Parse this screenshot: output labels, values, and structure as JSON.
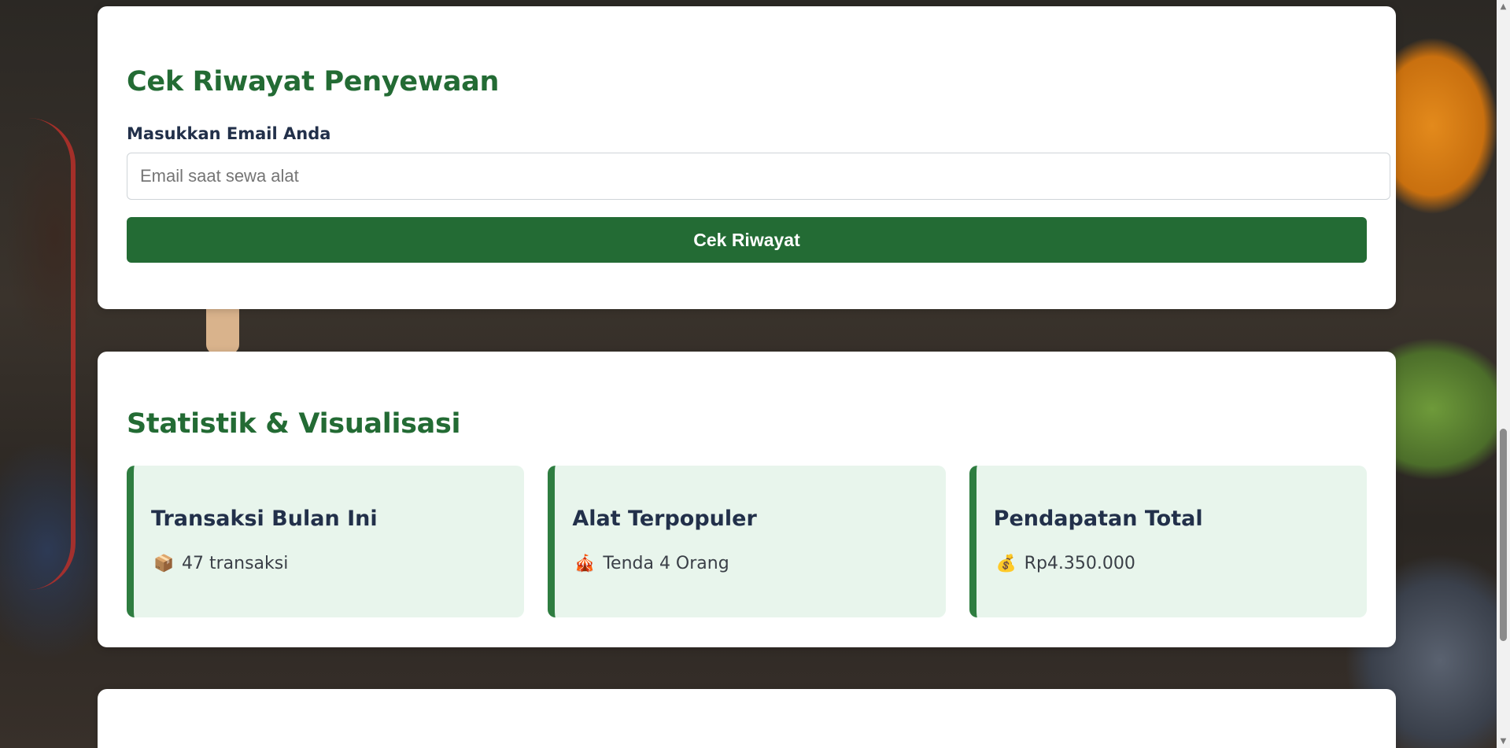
{
  "history": {
    "title": "Cek Riwayat Penyewaan",
    "email_label": "Masukkan Email Anda",
    "email_placeholder": "Email saat sewa alat",
    "email_value": "",
    "submit_label": "Cek Riwayat"
  },
  "stats": {
    "title": "Statistik & Visualisasi",
    "cards": [
      {
        "title": "Transaksi Bulan Ini",
        "icon": "package-icon",
        "glyph": "📦",
        "value": "47 transaksi"
      },
      {
        "title": "Alat Terpopuler",
        "icon": "tent-icon",
        "glyph": "🎪",
        "value": "Tenda 4 Orang"
      },
      {
        "title": "Pendapatan Total",
        "icon": "money-bag-icon",
        "glyph": "💰",
        "value": "Rp4.350.000"
      }
    ]
  },
  "colors": {
    "accent": "#236b34",
    "stat_background": "#e8f5ec",
    "heading_text": "#22304a"
  }
}
